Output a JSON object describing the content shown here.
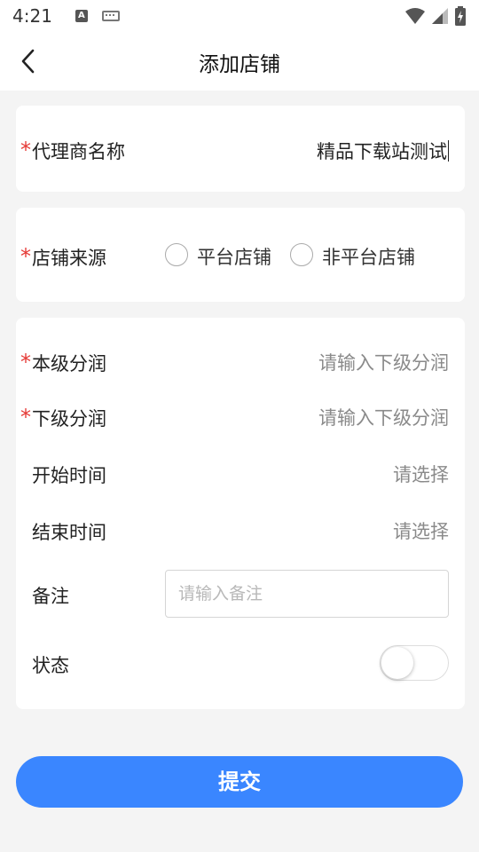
{
  "status_bar": {
    "time": "4:21",
    "a_icon": "A"
  },
  "header": {
    "title": "添加店铺"
  },
  "form": {
    "agent_name": {
      "required_mark": "*",
      "label": "代理商名称",
      "value": "精品下载站测试"
    },
    "shop_source": {
      "required_mark": "*",
      "label": "店铺来源",
      "options": [
        "平台店铺",
        "非平台店铺"
      ]
    },
    "this_level_share": {
      "required_mark": "*",
      "label": "本级分润",
      "placeholder": "请输入下级分润"
    },
    "lower_level_share": {
      "required_mark": "*",
      "label": "下级分润",
      "placeholder": "请输入下级分润"
    },
    "start_time": {
      "label": "开始时间",
      "placeholder": "请选择"
    },
    "end_time": {
      "label": "结束时间",
      "placeholder": "请选择"
    },
    "remark": {
      "label": "备注",
      "placeholder": "请输入备注"
    },
    "status": {
      "label": "状态"
    }
  },
  "submit_label": "提交",
  "icons": {
    "back": "chevron-left-icon",
    "wifi": "wifi-icon",
    "signal": "signal-icon",
    "battery": "battery-charging-icon",
    "keyboard": "keyboard-icon"
  },
  "colors": {
    "accent": "#3a86ff",
    "required": "#e53935",
    "background": "#f4f4f4"
  }
}
